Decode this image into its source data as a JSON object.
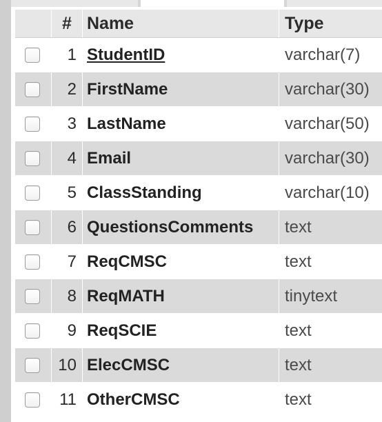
{
  "header": {
    "num_label": "#",
    "name_label": "Name",
    "type_label": "Type"
  },
  "rows": [
    {
      "num": "1",
      "name": "StudentID",
      "type": "varchar(7)",
      "primary_key": true,
      "checked": false
    },
    {
      "num": "2",
      "name": "FirstName",
      "type": "varchar(30)",
      "primary_key": false,
      "checked": false
    },
    {
      "num": "3",
      "name": "LastName",
      "type": "varchar(50)",
      "primary_key": false,
      "checked": false
    },
    {
      "num": "4",
      "name": "Email",
      "type": "varchar(30)",
      "primary_key": false,
      "checked": false
    },
    {
      "num": "5",
      "name": "ClassStanding",
      "type": "varchar(10)",
      "primary_key": false,
      "checked": false
    },
    {
      "num": "6",
      "name": "QuestionsComments",
      "type": "text",
      "primary_key": false,
      "checked": false
    },
    {
      "num": "7",
      "name": "ReqCMSC",
      "type": "text",
      "primary_key": false,
      "checked": false
    },
    {
      "num": "8",
      "name": "ReqMATH",
      "type": "tinytext",
      "primary_key": false,
      "checked": false
    },
    {
      "num": "9",
      "name": "ReqSCIE",
      "type": "text",
      "primary_key": false,
      "checked": false
    },
    {
      "num": "10",
      "name": "ElecCMSC",
      "type": "text",
      "primary_key": false,
      "checked": false
    },
    {
      "num": "11",
      "name": "OtherCMSC",
      "type": "text",
      "primary_key": false,
      "checked": false
    }
  ],
  "colors": {
    "row_alt": "#dadada",
    "row_plain": "#ffffff",
    "header_bg": "#e7e7e7"
  }
}
